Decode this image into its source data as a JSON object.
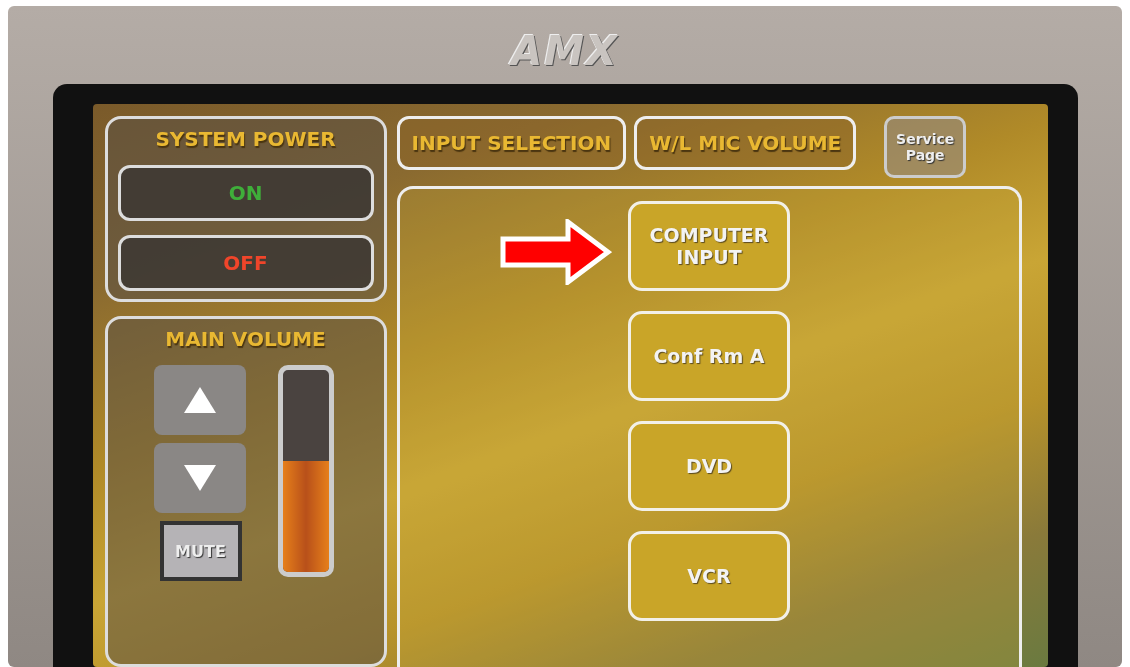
{
  "device": {
    "brand": "AMX"
  },
  "power": {
    "title": "SYSTEM POWER",
    "buttons": [
      {
        "label": "ON",
        "kind": "on"
      },
      {
        "label": "OFF",
        "kind": "off"
      }
    ]
  },
  "volume": {
    "title": "MAIN VOLUME",
    "mute": "MUTE",
    "level": 0.55
  },
  "tabs": [
    {
      "label": "INPUT SELECTION"
    },
    {
      "label": "W/L MIC VOLUME"
    }
  ],
  "service": {
    "label": "Service Page"
  },
  "inputs": [
    {
      "label": "COMPUTER INPUT",
      "pointed": true
    },
    {
      "label": "Conf Rm A",
      "pointed": false
    },
    {
      "label": "DVD",
      "pointed": false
    },
    {
      "label": "VCR",
      "pointed": false
    }
  ]
}
